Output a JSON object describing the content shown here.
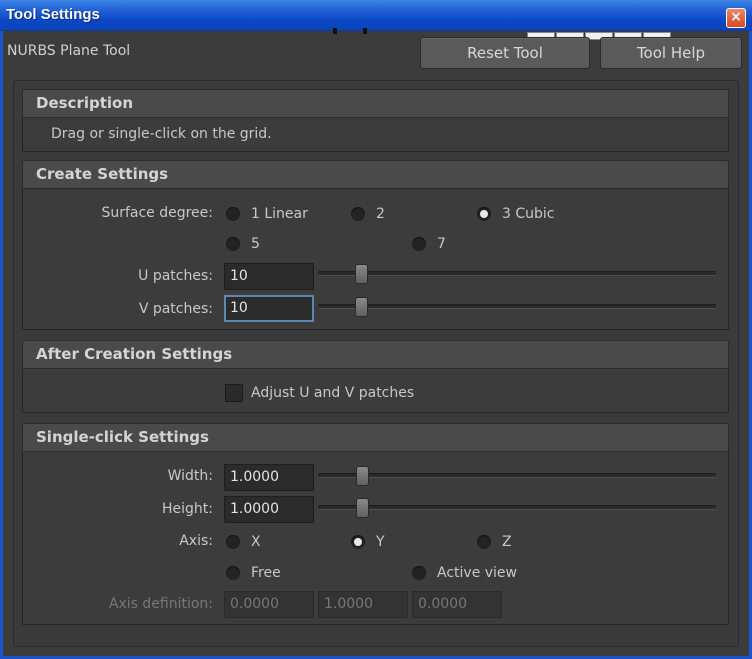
{
  "window": {
    "title": "Tool Settings",
    "close_label": "×"
  },
  "header": {
    "tool_name": "NURBS Plane Tool",
    "reset_label": "Reset Tool",
    "help_label": "Tool Help"
  },
  "description": {
    "heading": "Description",
    "text": "Drag or single-click on the grid."
  },
  "create": {
    "heading": "Create Settings",
    "surface_degree_label": "Surface degree:",
    "degrees": [
      "1 Linear",
      "2",
      "3 Cubic",
      "5",
      "7"
    ],
    "selected_degree": "3 Cubic",
    "u_label": "U patches:",
    "u_value": "10",
    "v_label": "V patches:",
    "v_value": "10"
  },
  "after": {
    "heading": "After Creation Settings",
    "adjust_label": "Adjust U and V patches",
    "adjust_checked": false
  },
  "single": {
    "heading": "Single-click Settings",
    "width_label": "Width:",
    "width_value": "1.0000",
    "height_label": "Height:",
    "height_value": "1.0000",
    "axis_label": "Axis:",
    "axes": [
      "X",
      "Y",
      "Z",
      "Free",
      "Active view"
    ],
    "selected_axis": "Y",
    "axis_def_label": "Axis definition:",
    "axis_def_values": [
      "0.0000",
      "1.0000",
      "0.0000"
    ]
  }
}
